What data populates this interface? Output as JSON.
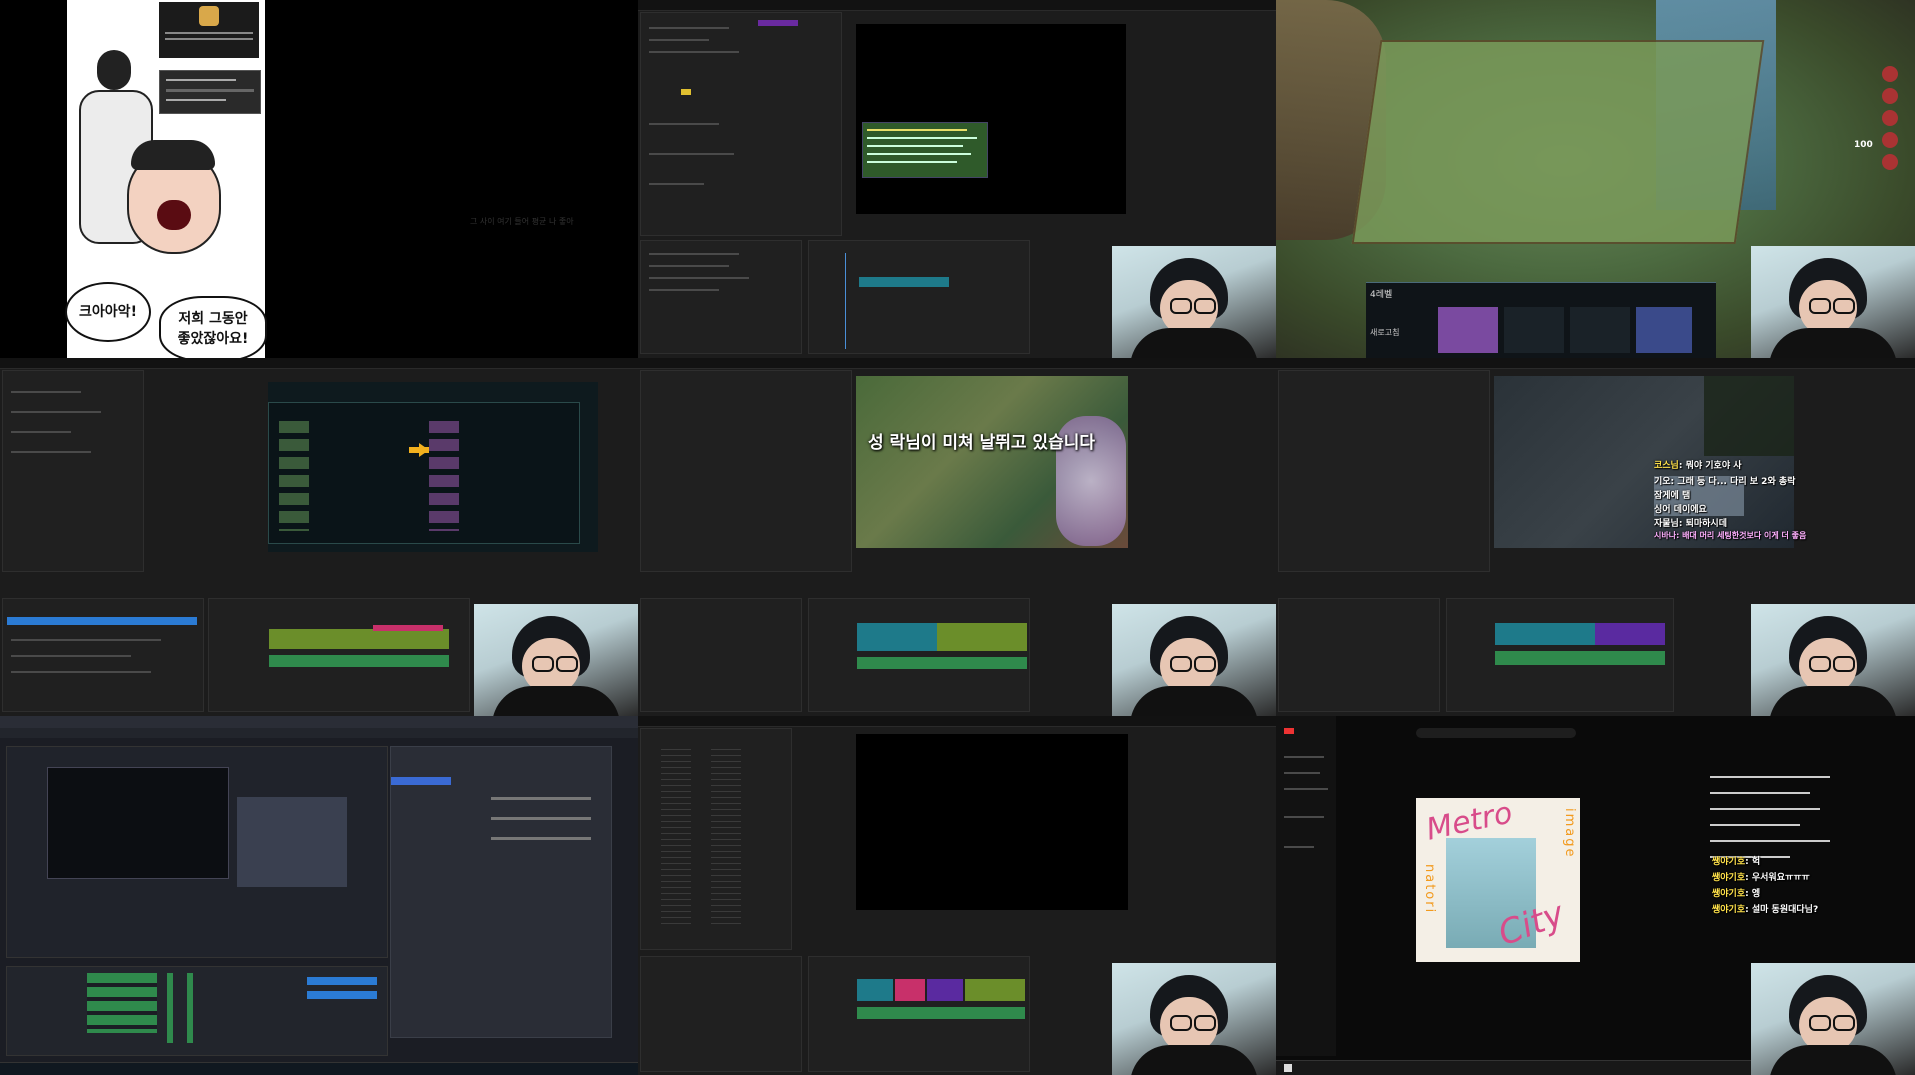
{
  "tile1": {
    "bubble_left": "크아아악!",
    "bubble_right_line1": "저희 그동안",
    "bubble_right_line2": "좋았잖아요!",
    "faint_caption": "그 사이 여기 들어 평균 나 좋아"
  },
  "tile5": {
    "subtitle": "성 락님이 미쳐 날뛰고 있습니다"
  },
  "tile6": {
    "chat": [
      {
        "nick": "코스님",
        "text": ": 뭐야 기호야 사 "
      },
      {
        "nick": "",
        "text": "기오: 그래 둥 다... 다리 보 2와 총락"
      },
      {
        "nick": "",
        "text": "잠게에 탬"
      },
      {
        "nick": "",
        "text": "싱어 데이에요"
      },
      {
        "nick": "",
        "text": "자물님: 퇴마하시데"
      },
      {
        "nick": "",
        "text": "시바나: 배대 머리 세팅한것보다 이게 더 좋음"
      }
    ]
  },
  "tile9": {
    "chat": [
      {
        "nick": "쌩야기호",
        "text": ": 헉"
      },
      {
        "nick": "쌩야기호",
        "text": ": 우서워요ㅠㅠㅠ"
      },
      {
        "nick": "쌩야기호",
        "text": ": 엥"
      },
      {
        "nick": "쌩야기호",
        "text": ": 설마 동원대다님?"
      }
    ],
    "album_text_1": "Metro",
    "album_text_2": "City",
    "album_text_3": "image",
    "album_text_4": "natori"
  },
  "tile3": {
    "level_label": "4레벨",
    "sub_label": "새로고침",
    "hp_value": "100"
  },
  "colors": {
    "pp_bg": "#1c1c1c",
    "clip_teal": "#1e7a8a",
    "clip_green": "#6b8e2a",
    "clip_purple": "#5a2aa0",
    "audio_green": "#2f8a4c",
    "accent_blue": "#2b7bd4"
  }
}
